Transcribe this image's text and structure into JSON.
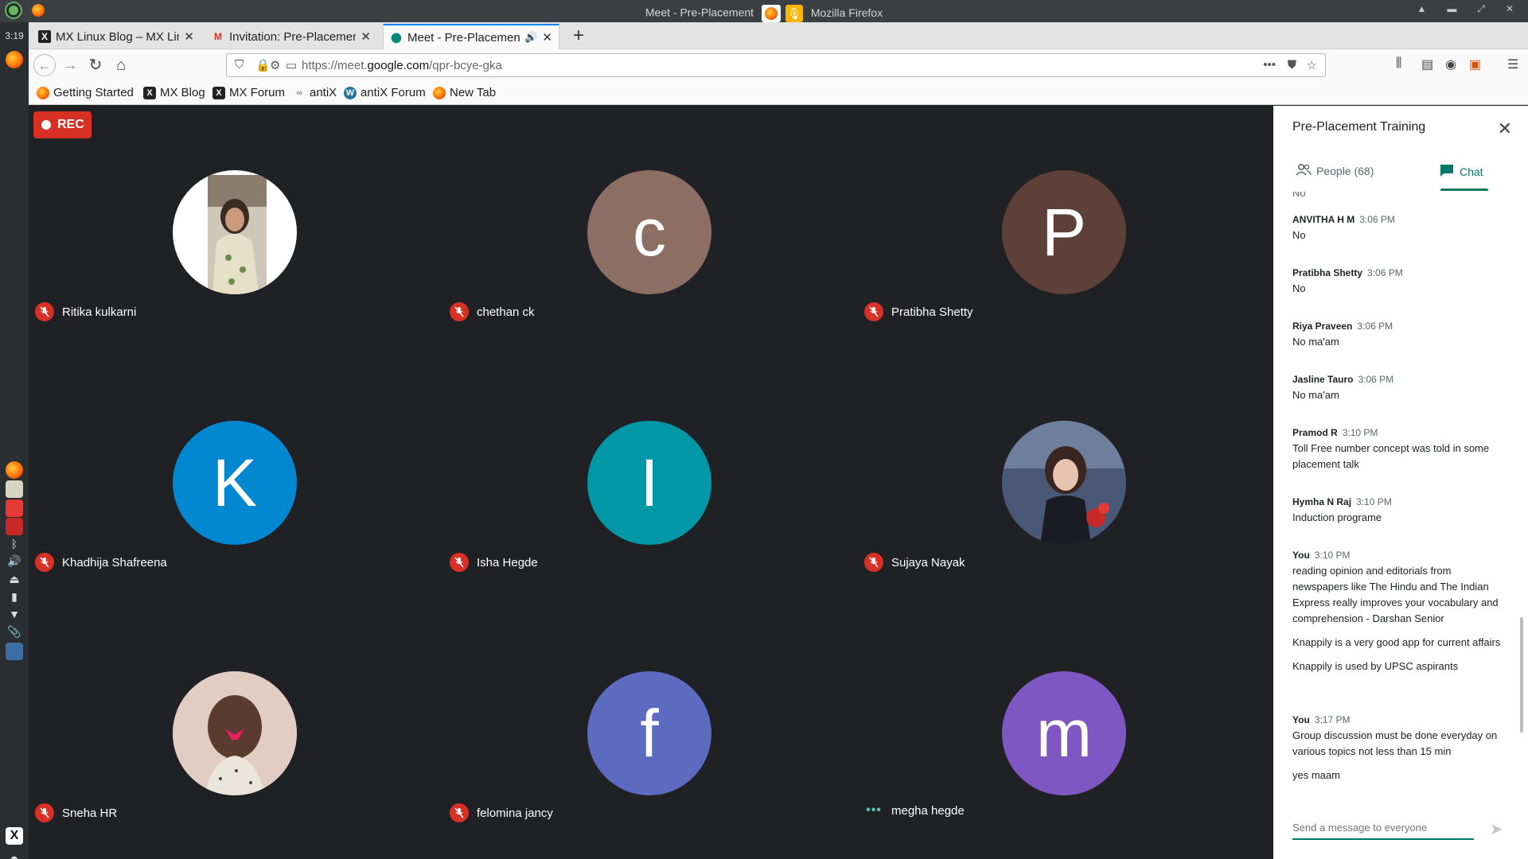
{
  "window": {
    "title_left": "Meet - Pre-Placement",
    "title_right": "Mozilla Firefox",
    "clock": "3:19"
  },
  "tabs": [
    {
      "title": "MX Linux Blog – MX Linux",
      "favicon": "X",
      "favicon_color": "#222222"
    },
    {
      "title": "Invitation: Pre-Placement",
      "favicon": "M",
      "favicon_color": "#d93025"
    },
    {
      "title": "Meet - Pre-Placement",
      "favicon": "meet",
      "favicon_color": "#00897b",
      "active": true,
      "audio": true
    }
  ],
  "urlbar": {
    "url_prefix": "https://meet.",
    "url_domain": "google.com",
    "url_suffix": "/qpr-bcye-gka"
  },
  "bookmarks": [
    {
      "label": "Getting Started",
      "icon": "firefox-icon",
      "color": "#ff7139"
    },
    {
      "label": "MX Blog",
      "icon": "x-icon",
      "color": "#222222"
    },
    {
      "label": "MX Forum",
      "icon": "x-icon",
      "color": "#222222"
    },
    {
      "label": "antiX",
      "icon": "antix-icon",
      "color": "#888888"
    },
    {
      "label": "antiX Forum",
      "icon": "wordpress-icon",
      "color": "#21759b"
    },
    {
      "label": "New Tab",
      "icon": "firefox-icon",
      "color": "#ff7139"
    }
  ],
  "meet": {
    "rec_label": "REC",
    "participants": [
      {
        "name": "Ritika kulkarni",
        "initial": "",
        "color": "#ffffff",
        "photo": "portrait-photo",
        "status": "muted"
      },
      {
        "name": "chethan ck",
        "initial": "c",
        "color": "#8d6e63",
        "status": "muted"
      },
      {
        "name": "Pratibha Shetty",
        "initial": "P",
        "color": "#5d4037",
        "status": "muted"
      },
      {
        "name": "Khadhija Shafreena",
        "initial": "K",
        "color": "#0288d1",
        "status": "muted"
      },
      {
        "name": "Isha Hegde",
        "initial": "I",
        "color": "#0097a7",
        "status": "muted"
      },
      {
        "name": "Sujaya Nayak",
        "initial": "",
        "color": "#33415c",
        "photo": "anime-photo",
        "status": "muted"
      },
      {
        "name": "Sneha HR",
        "initial": "",
        "color": "#c9a9a6",
        "photo": "girl-photo",
        "status": "muted"
      },
      {
        "name": "felomina jancy",
        "initial": "f",
        "color": "#5c6bc0",
        "status": "muted"
      },
      {
        "name": "megha hegde",
        "initial": "m",
        "color": "#7e57c2",
        "status": "speaking"
      }
    ]
  },
  "panel": {
    "title": "Pre-Placement Training",
    "people_tab": "People (68)",
    "chat_tab": "Chat",
    "partial_top": "No",
    "messages": [
      {
        "sender": "ANVITHA H M",
        "time": "3:06 PM",
        "lines": [
          "No"
        ]
      },
      {
        "sender": "Pratibha Shetty",
        "time": "3:06 PM",
        "lines": [
          "No"
        ]
      },
      {
        "sender": "Riya Praveen",
        "time": "3:06 PM",
        "lines": [
          "No ma'am"
        ]
      },
      {
        "sender": "Jasline Tauro",
        "time": "3:06 PM",
        "lines": [
          "No ma'am"
        ]
      },
      {
        "sender": "Pramod R",
        "time": "3:10 PM",
        "lines": [
          "Toll Free number concept was told in some placement talk"
        ]
      },
      {
        "sender": "Hymha N Raj",
        "time": "3:10 PM",
        "lines": [
          "Induction programe"
        ]
      },
      {
        "sender": "You",
        "time": "3:10 PM",
        "lines": [
          "reading opinion and editorials from newspapers like The Hindu and The Indian Express really improves your vocabulary and comprehension - Darshan Senior",
          "Knappily is a very good app for current affairs",
          "Knappily is used by UPSC aspirants"
        ]
      },
      {
        "sender": "You",
        "time": "3:17 PM",
        "lines": [
          "Group discussion must be done everyday on various topics not less than 15 min",
          "yes maam"
        ]
      }
    ],
    "composer_placeholder": "Send a message to everyone"
  }
}
